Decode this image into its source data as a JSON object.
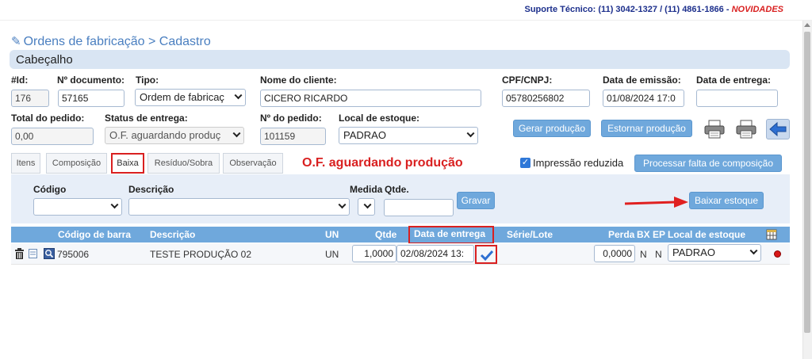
{
  "support": {
    "text": "Suporte Técnico: (11) 3042-1327 / (11) 4861-1866 -",
    "novidades": "NOVIDADES"
  },
  "page_title": "Ordens de fabricação > Cadastro",
  "section_title": "Cabeçalho",
  "fields": {
    "id": {
      "label": "#Id:",
      "value": "176"
    },
    "documento": {
      "label": "Nº documento:",
      "value": "57165"
    },
    "tipo": {
      "label": "Tipo:",
      "value": "Ordem de fabricaç"
    },
    "cliente": {
      "label": "Nome do cliente:",
      "value": "CICERO RICARDO"
    },
    "cpf": {
      "label": "CPF/CNPJ:",
      "value": "05780256802"
    },
    "emissao": {
      "label": "Data de emissão:",
      "value": "01/08/2024 17:0"
    },
    "entrega": {
      "label": "Data de entrega:",
      "value": ""
    },
    "total": {
      "label": "Total do pedido:",
      "value": "0,00"
    },
    "status": {
      "label": "Status de entrega:",
      "value": "O.F. aguardando produç"
    },
    "pedido": {
      "label": "Nº do pedido:",
      "value": "101159"
    },
    "local": {
      "label": "Local de estoque:",
      "value": "PADRAO"
    }
  },
  "buttons": {
    "gerar": "Gerar produção",
    "estornar": "Estornar produção",
    "processar": "Processar falta de composição",
    "gravar": "Gravar",
    "baixar": "Baixar estoque"
  },
  "tabs": [
    {
      "label": "Itens"
    },
    {
      "label": "Composição"
    },
    {
      "label": "Baixa"
    },
    {
      "label": "Resíduo/Sobra"
    },
    {
      "label": "Observação"
    }
  ],
  "status_message": "O.F. aguardando produção",
  "impressao_reduzida": {
    "label": "Impressão reduzida",
    "checked": true
  },
  "filter": {
    "codigo": "Código",
    "descricao": "Descrição",
    "medida": "Medida",
    "qtde": "Qtde."
  },
  "grid": {
    "headers": {
      "codigo_barra": "Código de barra",
      "descricao": "Descrição",
      "un": "UN",
      "qtde": "Qtde",
      "data_entrega": "Data de entrega",
      "serie_lote": "Série/Lote",
      "perda": "Perda",
      "bx": "BX",
      "ep": "EP",
      "local": "Local de estoque"
    },
    "rows": [
      {
        "codigo_barra": "795006",
        "descricao": "TESTE PRODUÇÃO 02",
        "un": "UN",
        "qtde": "1,0000",
        "data_entrega": "02/08/2024 13:",
        "perda": "0,0000",
        "bx": "N",
        "ep": "N",
        "local": "PADRAO"
      }
    ]
  },
  "colors": {
    "accent": "#6fa8dc",
    "highlight": "#d92020",
    "section_bg": "#d9e5f3"
  }
}
